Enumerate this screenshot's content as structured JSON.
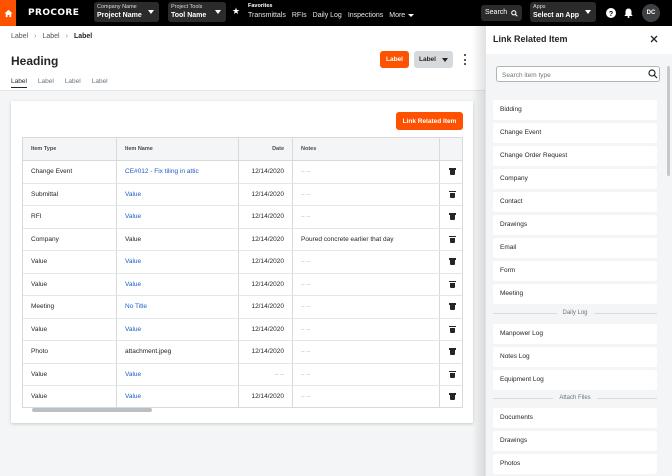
{
  "topbar": {
    "logo": "PROCORE",
    "company": {
      "small": "Company Name",
      "big": "Project Name"
    },
    "tools": {
      "small": "Project Tools",
      "big": "Tool Name"
    },
    "favorites_title": "Favorites",
    "favorites": [
      "Transmittals",
      "RFIs",
      "Daily Log",
      "Inspections"
    ],
    "more": "More",
    "search": "Search",
    "apps": {
      "small": "Apps",
      "big": "Select an App"
    },
    "avatar": "DC",
    "accent": "#ff5200"
  },
  "breadcrumbs": [
    "Label",
    "Label",
    "Label"
  ],
  "page": {
    "heading": "Heading",
    "primary_button": "Label",
    "secondary_button": "Label",
    "tabs": [
      "Label",
      "Label",
      "Label",
      "Label"
    ]
  },
  "card": {
    "action_button": "Link Related Item"
  },
  "table": {
    "headers": [
      "Item Type",
      "Item Name",
      "Date",
      "Notes"
    ],
    "rows": [
      {
        "type": "Change Event",
        "name": "CE#012 - Fix tiling in attic",
        "link": true,
        "date": "12/14/2020",
        "notes": "– –"
      },
      {
        "type": "Submittal",
        "name": "Value",
        "link": true,
        "date": "12/14/2020",
        "notes": "– –"
      },
      {
        "type": "RFI",
        "name": "Value",
        "link": true,
        "date": "12/14/2020",
        "notes": "– –"
      },
      {
        "type": "Company",
        "name": "Value",
        "link": false,
        "date": "12/14/2020",
        "notes": "Poured concrete earlier that day"
      },
      {
        "type": "Value",
        "name": "Value",
        "link": true,
        "date": "12/14/2020",
        "notes": "– –"
      },
      {
        "type": "Value",
        "name": "Value",
        "link": true,
        "date": "12/14/2020",
        "notes": "– –"
      },
      {
        "type": "Meeting",
        "name": "No Title",
        "link": true,
        "date": "12/14/2020",
        "notes": "– –"
      },
      {
        "type": "Value",
        "name": "Value",
        "link": true,
        "date": "12/14/2020",
        "notes": "– –"
      },
      {
        "type": "Photo",
        "name": "attachment.jpeg",
        "link": false,
        "date": "12/14/2020",
        "notes": "– –"
      },
      {
        "type": "Value",
        "name": "Value",
        "link": true,
        "date": "– –",
        "notes": "– –"
      },
      {
        "type": "Value",
        "name": "Value",
        "link": true,
        "date": "12/14/2020",
        "notes": "– –"
      }
    ]
  },
  "panel": {
    "title": "Link Related Item",
    "search_placeholder": "Search item type",
    "items": [
      "Bidding",
      "Change Event",
      "Change Order Request",
      "Company",
      "Contact",
      "Drawings",
      "Email",
      "Form",
      "Meeting"
    ],
    "section_daily_log": "Daily Log",
    "daily_log_items": [
      "Manpower Log",
      "Notes Log",
      "Equipment Log"
    ],
    "section_attach": "Attach Files",
    "attach_items": [
      "Documents",
      "Drawings",
      "Photos"
    ]
  }
}
